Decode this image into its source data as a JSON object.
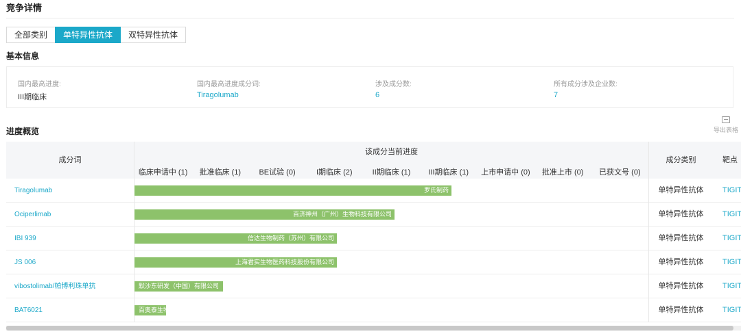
{
  "page": {
    "title": "竞争详情",
    "tabs": [
      {
        "label": "全部类别",
        "active": false
      },
      {
        "label": "单特异性抗体",
        "active": true
      },
      {
        "label": "双特异性抗体",
        "active": false
      }
    ]
  },
  "basic": {
    "section_title": "基本信息",
    "items": [
      {
        "label": "国内最高进度:",
        "value": "III期临床",
        "link": false
      },
      {
        "label": "国内最高进度成分词:",
        "value": "Tiragolumab",
        "link": true
      },
      {
        "label": "涉及成分数:",
        "value": "6",
        "link": true
      },
      {
        "label": "所有成分涉及企业数:",
        "value": "7",
        "link": true
      }
    ]
  },
  "progress": {
    "section_title": "进度概览",
    "export_label": "导出表格",
    "export_icon": "export-table-icon",
    "table": {
      "name_header": "成分词",
      "progress_header": "该成分当前进度",
      "stages": [
        "临床申请中 (1)",
        "批准临床 (1)",
        "BE试验 (0)",
        "I期临床 (2)",
        "II期临床 (1)",
        "III期临床 (1)",
        "上市申请中 (0)",
        "批准上市 (0)",
        "已获文号 (0)"
      ],
      "category_header": "成分类别",
      "target_header": "靶点",
      "rows": [
        {
          "name": "Tiragolumab",
          "company": "罗氏制药",
          "stage_reached": 6,
          "category": "单特异性抗体",
          "target": "TIGIT"
        },
        {
          "name": "Ociperlimab",
          "company": "百济神州（广州）生物科技有限公司",
          "stage_reached": 5,
          "category": "单特异性抗体",
          "target": "TIGIT"
        },
        {
          "name": "IBI 939",
          "company": "信达生物制药（苏州）有限公司",
          "stage_reached": 4,
          "category": "单特异性抗体",
          "target": "TIGIT"
        },
        {
          "name": "JS 006",
          "company": "上海君实生物医药科技股份有限公司",
          "stage_reached": 4,
          "category": "单特异性抗体",
          "target": "TIGIT"
        },
        {
          "name": "vibostolimab/帕博利珠单抗",
          "company": "默沙东研发（中国）有限公司",
          "stage_reached": 2,
          "category": "单特异性抗体",
          "target": "TIGIT"
        },
        {
          "name": "BAT6021",
          "company": "百奥泰生物制...",
          "stage_reached": 1,
          "category": "单特异性抗体",
          "target": "TIGIT"
        }
      ]
    }
  }
}
